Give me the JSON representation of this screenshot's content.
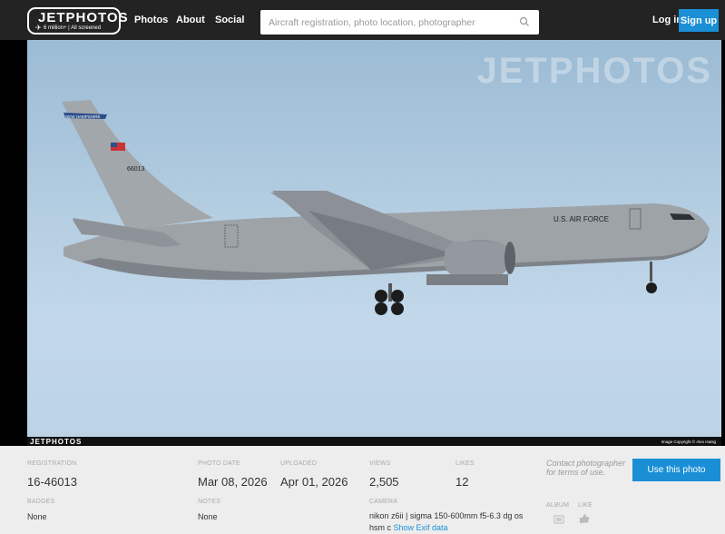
{
  "header": {
    "logo": {
      "main": "JETPHOTOS",
      "sub": "6 million+ | All screened"
    },
    "nav": [
      "Photos",
      "About",
      "Social"
    ],
    "search": {
      "placeholder": "Aircraft registration, photo location, photographer",
      "value": ""
    },
    "login_label": "Log in",
    "signup_label": "Sign up"
  },
  "photo": {
    "watermark": "JETPHOTOS",
    "corner_logo": "JETPHOTOS",
    "copyright": "Image Copyright © Alex Hanig",
    "tail_banner": "NEW HAMPSHIRE",
    "tail_number": "66013",
    "fuselage_text": "U.S. AIR FORCE"
  },
  "details": {
    "registration": {
      "label": "REGISTRATION",
      "value": "16-46013"
    },
    "photo_date": {
      "label": "PHOTO DATE",
      "value": "Mar 08, 2026"
    },
    "uploaded": {
      "label": "UPLOADED",
      "value": "Apr 01, 2026"
    },
    "views": {
      "label": "VIEWS",
      "value": "2,505"
    },
    "likes": {
      "label": "LIKES",
      "value": "12"
    },
    "badges": {
      "label": "BADGES",
      "value": "None"
    },
    "notes": {
      "label": "NOTES",
      "value": "None"
    },
    "camera": {
      "label": "CAMERA",
      "value": "nikon z6ii | sigma 150-600mm f5-6.3 dg os hsm c",
      "exif_link": "Show Exif data"
    },
    "contact": "Contact photographer for terms of use.",
    "use_photo_label": "Use this photo",
    "album_label": "ALBUM",
    "like_label": "LIKE"
  },
  "colors": {
    "accent": "#1a8fd6",
    "topbar": "#232323",
    "info_bg": "#ededed"
  },
  "icons": [
    "plane-icon",
    "search-icon",
    "album-icon",
    "thumbs-up-icon"
  ]
}
